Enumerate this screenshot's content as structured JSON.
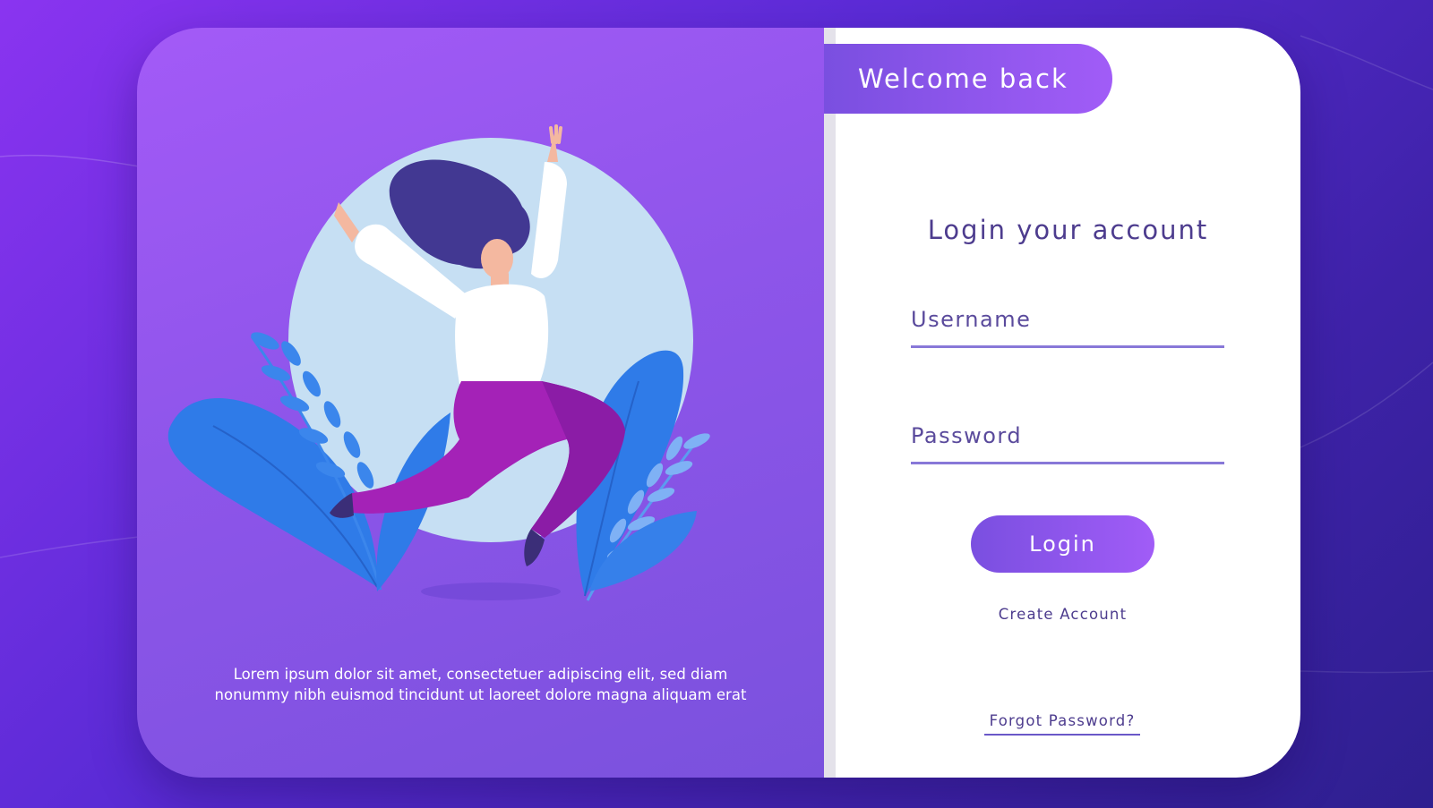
{
  "colors": {
    "accent_start": "#7a4fe0",
    "accent_end": "#a15cf7",
    "text_primary": "#4d3c8e",
    "input_line": "#8878d8"
  },
  "left_panel": {
    "caption_line1": "Lorem ipsum dolor sit amet, consectetuer adipiscing elit, sed diam",
    "caption_line2": "nonummy nibh euismod tincidunt ut laoreet dolore magna aliquam erat"
  },
  "right_panel": {
    "welcome": "Welcome back",
    "title": "Login your account",
    "username_label": "Username",
    "password_label": "Password",
    "login_button": "Login",
    "create_account": "Create Account",
    "forgot_password": "Forgot Password?"
  }
}
